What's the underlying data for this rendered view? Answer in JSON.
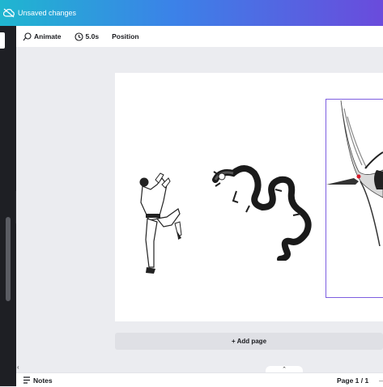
{
  "topbar": {
    "status": "Unsaved changes",
    "icon": "cloud-icon"
  },
  "toolbar": {
    "animate_label": "Animate",
    "duration_label": "5.0s",
    "position_label": "Position"
  },
  "canvas": {
    "add_page_label": "+ Add page",
    "collapse_caret": "‹",
    "scroll_caret": "‹",
    "pill_caret": "⌃"
  },
  "footer": {
    "notes_label": "Notes",
    "page_indicator": "Page 1 / 1",
    "dash": "—"
  },
  "colors": {
    "accent_selection": "#7d5ee0",
    "topbar_start": "#1fb6d0",
    "topbar_end": "#6a4bdc",
    "sidebar": "#1e1f24"
  }
}
